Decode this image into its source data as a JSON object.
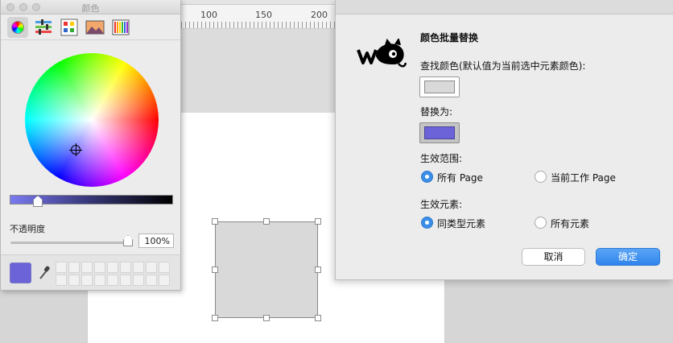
{
  "colors": {
    "accent": "#3b8fe9",
    "current_color": "#6d63d9",
    "find_color": "#d9d9d9"
  },
  "ruler": {
    "labels": [
      "100",
      "150",
      "200"
    ]
  },
  "color_panel": {
    "title": "颜色",
    "modes": [
      {
        "icon": "color-wheel-icon",
        "selected": true
      },
      {
        "icon": "sliders-icon",
        "selected": false
      },
      {
        "icon": "palettes-icon",
        "selected": false
      },
      {
        "icon": "image-palette-icon",
        "selected": false
      },
      {
        "icon": "pencils-icon",
        "selected": false
      }
    ],
    "opacity_label": "不透明度",
    "opacity_value": "100%",
    "opacity_fraction": 1.0,
    "brightness_fraction": 0.17
  },
  "dialog": {
    "title": "颜色批量替换",
    "find_label": "查找颜色(默认值为当前选中元素颜色):",
    "replace_label": "替换为:",
    "scope_label": "生效范围:",
    "scope_options": [
      "所有 Page",
      "当前工作 Page"
    ],
    "scope_selected": 0,
    "elements_label": "生效元素:",
    "element_options": [
      "同类型元素",
      "所有元素"
    ],
    "element_selected": 0,
    "cancel_label": "取消",
    "ok_label": "确定"
  }
}
